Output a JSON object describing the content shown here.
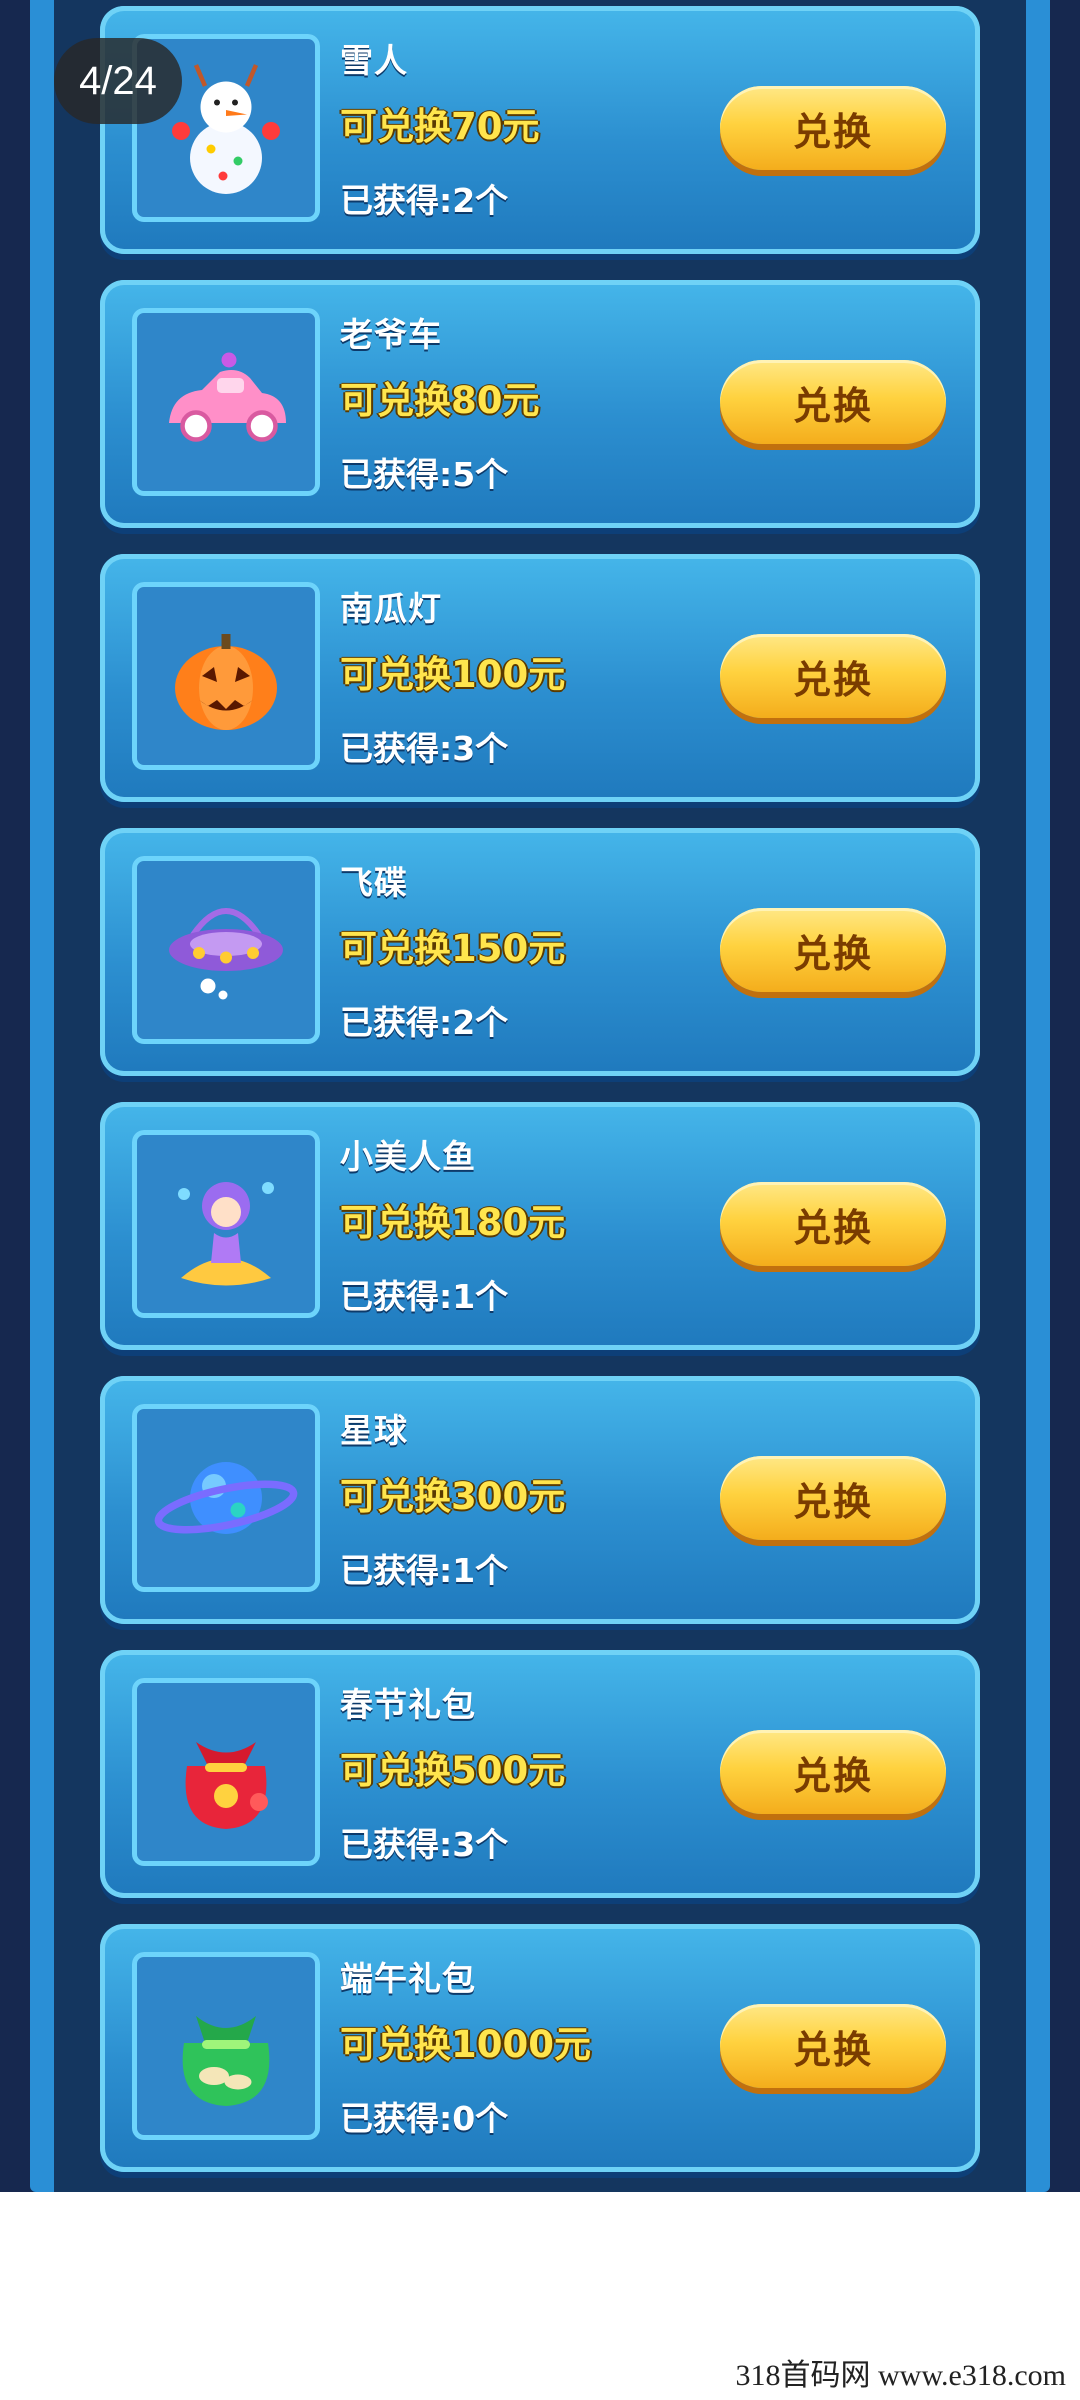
{
  "page_counter": "4/24",
  "redeem_label": "兑换",
  "items": [
    {
      "name": "雪人",
      "value": "可兑换70元",
      "owned": "已获得:2个",
      "icon": "snowman-icon"
    },
    {
      "name": "老爷车",
      "value": "可兑换80元",
      "owned": "已获得:5个",
      "icon": "vintage-car-icon"
    },
    {
      "name": "南瓜灯",
      "value": "可兑换100元",
      "owned": "已获得:3个",
      "icon": "pumpkin-lantern-icon"
    },
    {
      "name": "飞碟",
      "value": "可兑换150元",
      "owned": "已获得:2个",
      "icon": "ufo-icon"
    },
    {
      "name": "小美人鱼",
      "value": "可兑换180元",
      "owned": "已获得:1个",
      "icon": "mermaid-icon"
    },
    {
      "name": "星球",
      "value": "可兑换300元",
      "owned": "已获得:1个",
      "icon": "planet-icon"
    },
    {
      "name": "春节礼包",
      "value": "可兑换500元",
      "owned": "已获得:3个",
      "icon": "spring-festival-gift-bag-icon"
    },
    {
      "name": "端午礼包",
      "value": "可兑换1000元",
      "owned": "已获得:0个",
      "icon": "dragon-boat-gift-bag-icon"
    }
  ],
  "watermark": "318首码网  www.e318.com"
}
